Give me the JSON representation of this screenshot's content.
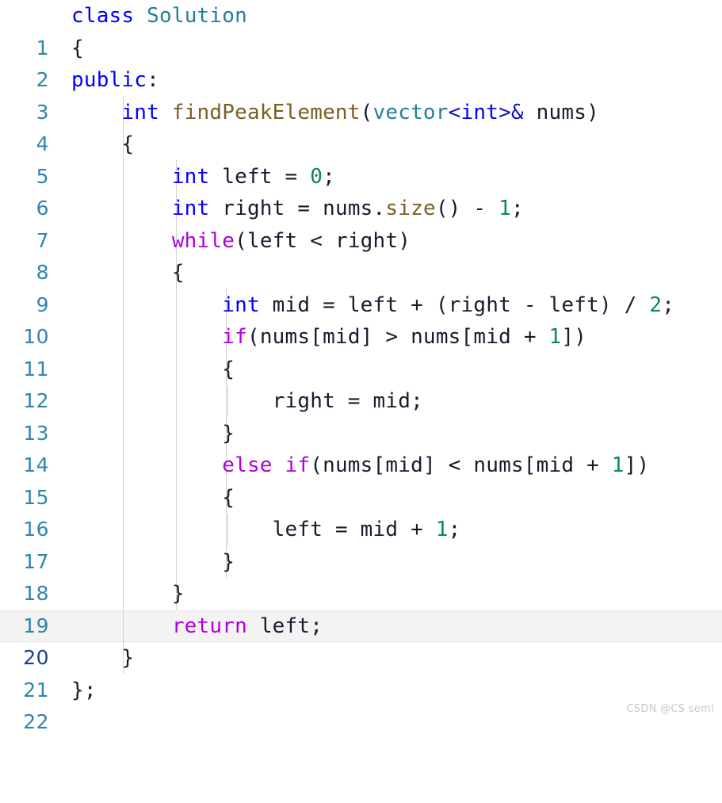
{
  "editor": {
    "language": "cpp",
    "active_line": 20,
    "total_lines": 22,
    "background": "#ffffff",
    "line_number_color": "#2e86ab",
    "active_line_number_color": "#1b3f8b",
    "active_line_background": "#f3f3f3",
    "indent_guide_color": "#d0d0d0",
    "palette": {
      "keyword": "#0000ff",
      "control": "#af00db",
      "type": "#267f99",
      "function": "#795e26",
      "number": "#09885a",
      "identifier": "#1a1a2e"
    }
  },
  "line_numbers": [
    "1",
    "2",
    "3",
    "4",
    "5",
    "6",
    "7",
    "8",
    "9",
    "10",
    "11",
    "12",
    "13",
    "14",
    "15",
    "16",
    "17",
    "18",
    "19",
    "20",
    "21",
    "22"
  ],
  "code_lines": [
    {
      "n": "1",
      "text": "class Solution"
    },
    {
      "n": "2",
      "text": "{"
    },
    {
      "n": "3",
      "text": "public:"
    },
    {
      "n": "4",
      "text": "    int findPeakElement(vector<int>& nums)"
    },
    {
      "n": "5",
      "text": "    {"
    },
    {
      "n": "6",
      "text": "        int left = 0;"
    },
    {
      "n": "7",
      "text": "        int right = nums.size() - 1;"
    },
    {
      "n": "8",
      "text": "        while(left < right)"
    },
    {
      "n": "9",
      "text": "        {"
    },
    {
      "n": "10",
      "text": "            int mid = left + (right - left) / 2;"
    },
    {
      "n": "11",
      "text": "            if(nums[mid] > nums[mid + 1])"
    },
    {
      "n": "12",
      "text": "            {"
    },
    {
      "n": "13",
      "text": "                right = mid;"
    },
    {
      "n": "14",
      "text": "            }"
    },
    {
      "n": "15",
      "text": "            else if(nums[mid] < nums[mid + 1])"
    },
    {
      "n": "16",
      "text": "            {"
    },
    {
      "n": "17",
      "text": "                left = mid + 1;"
    },
    {
      "n": "18",
      "text": "            }"
    },
    {
      "n": "19",
      "text": "        }"
    },
    {
      "n": "20",
      "text": "        return left;"
    },
    {
      "n": "21",
      "text": "    }"
    },
    {
      "n": "22",
      "text": "};"
    }
  ],
  "watermark": {
    "text": "CSDN @CS semi"
  }
}
